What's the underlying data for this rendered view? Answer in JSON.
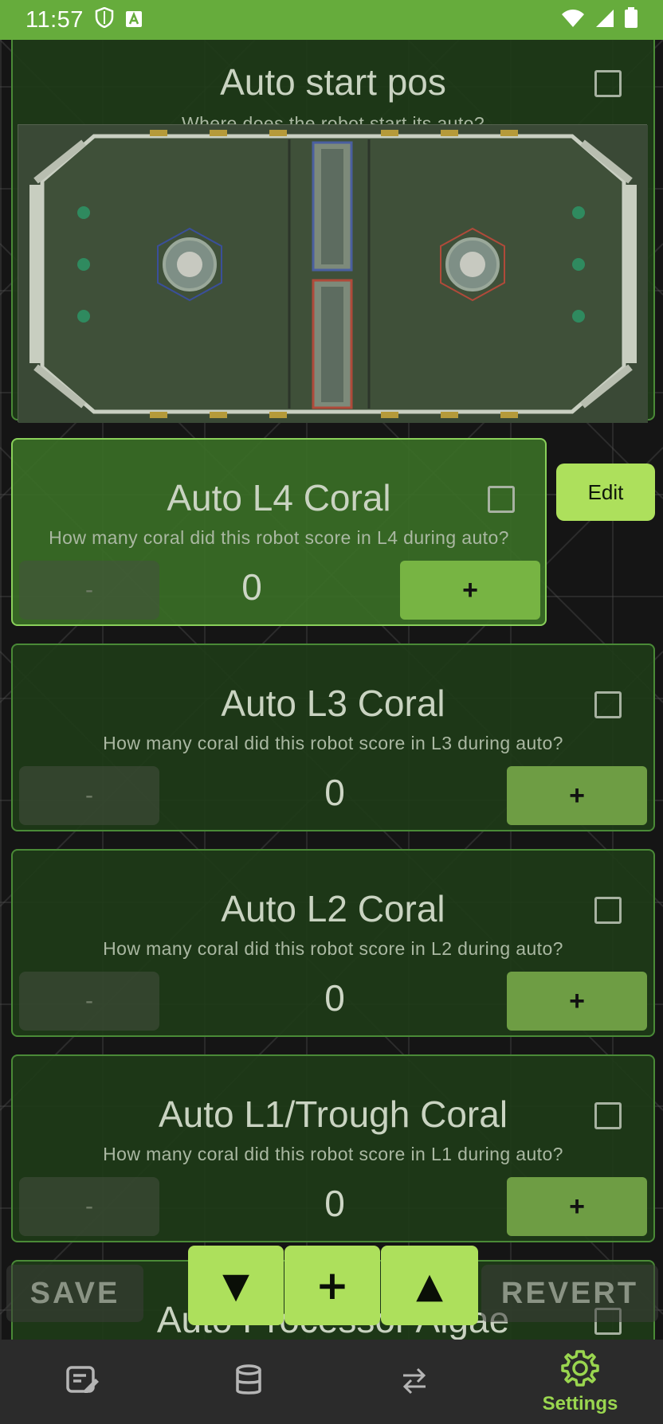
{
  "status_bar": {
    "time": "11:57",
    "icons_left": [
      "shield-icon",
      "font-a-icon"
    ],
    "icons_right": [
      "wifi-icon",
      "signal-icon",
      "battery-icon"
    ]
  },
  "colors": {
    "accent": "#ade05c",
    "status_bar": "#66ac3c",
    "card_border": "#4a8a37",
    "nav_active": "#9ad64f"
  },
  "auto_start_pos": {
    "title": "Auto start pos",
    "subtitle": "Where does the robot start its auto?"
  },
  "counters": [
    {
      "title": "Auto L4 Coral",
      "subtitle": "How many coral did this robot score in L4 during auto?",
      "value": "0",
      "minus_label": "-",
      "plus_label": "+"
    },
    {
      "title": "Auto L3 Coral",
      "subtitle": "How many coral did this robot score in L3 during auto?",
      "value": "0",
      "minus_label": "-",
      "plus_label": "+"
    },
    {
      "title": "Auto L2 Coral",
      "subtitle": "How many coral did this robot score in L2 during auto?",
      "value": "0",
      "minus_label": "-",
      "plus_label": "+"
    },
    {
      "title": "Auto L1/Trough Coral",
      "subtitle": "How many coral did this robot score in L1 during auto?",
      "value": "0",
      "minus_label": "-",
      "plus_label": "+"
    }
  ],
  "partial_card": {
    "title": "Auto Processor Algae"
  },
  "edit_label": "Edit",
  "toolbar": {
    "save_label": "SAVE",
    "revert_label": "REVERT",
    "down_label": "▼",
    "add_label": "+",
    "up_label": "▲"
  },
  "nav": {
    "items": [
      {
        "icon": "edit-note-icon",
        "label": ""
      },
      {
        "icon": "database-icon",
        "label": ""
      },
      {
        "icon": "sync-arrows-icon",
        "label": ""
      },
      {
        "icon": "gear-icon",
        "label": "Settings"
      }
    ]
  }
}
